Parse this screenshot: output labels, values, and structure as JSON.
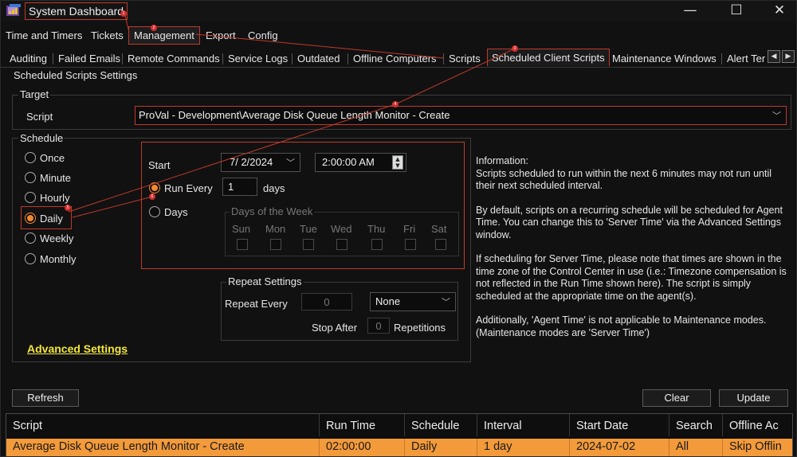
{
  "window": {
    "title": "System Dashboard",
    "minimize": "—",
    "maximize": "☐",
    "close": "✕"
  },
  "menu": [
    "Time and Timers",
    "Tickets",
    "Management",
    "Export",
    "Config"
  ],
  "tabs": [
    "Auditing",
    "Failed Emails",
    "Remote Commands",
    "Service Logs",
    "Outdated",
    "Offline Computers",
    "Scripts",
    "Scheduled Client Scripts",
    "Maintenance Windows",
    "Alert Ter"
  ],
  "panel_title": "Scheduled Scripts Settings",
  "target": {
    "group_label": "Target",
    "script_label": "Script",
    "script_value": "ProVal - Development\\Average Disk Queue Length Monitor - Create"
  },
  "schedule": {
    "group_label": "Schedule",
    "options": [
      "Once",
      "Minute",
      "Hourly",
      "Daily",
      "Weekly",
      "Monthly"
    ],
    "selected": "Daily",
    "start_label": "Start",
    "start_date": "7/  2/2024",
    "start_time": "2:00:00 AM",
    "run_every_label": "Run Every",
    "run_every_value": "1",
    "run_every_unit": "days",
    "days_label": "Days",
    "days_of_week_label": "Days of the Week",
    "weekdays": [
      "Sun",
      "Mon",
      "Tue",
      "Wed",
      "Thu",
      "Fri",
      "Sat"
    ]
  },
  "repeat": {
    "group_label": "Repeat Settings",
    "repeat_every_label": "Repeat Every",
    "repeat_every_value": "0",
    "unit_value": "None",
    "stop_after_label": "Stop After",
    "stop_after_value": "0",
    "repetitions_label": "Repetitions"
  },
  "info": [
    "Information:\nScripts scheduled to run within the next 6 minutes may not run until their next scheduled interval.",
    "By default, scripts on a recurring schedule will be scheduled for Agent Time. You can change this to 'Server Time' via the Advanced Settings window.",
    "If scheduling for Server Time, please note that times are shown in the time zone of the Control Center in use (i.e.: Timezone compensation is not reflected in the Run Time shown here). The script is simply scheduled at the appropriate time on the agent(s).",
    "Additionally, 'Agent Time' is not applicable to Maintenance modes. (Maintenance modes are 'Server Time')"
  ],
  "advanced_settings": "Advanced Settings",
  "buttons": {
    "refresh": "Refresh",
    "clear": "Clear",
    "update": "Update"
  },
  "grid": {
    "columns": [
      "Script",
      "Run Time",
      "Schedule",
      "Interval",
      "Start Date",
      "Search",
      "Offline Ac"
    ],
    "rows": [
      [
        "Average Disk Queue Length Monitor - Create",
        "02:00:00",
        "Daily",
        "1 day",
        "2024-07-02",
        "All",
        "Skip Offlin"
      ]
    ]
  },
  "annotations": [
    "1",
    "2",
    "3",
    "4",
    "5",
    "6"
  ],
  "colors": {
    "highlight": "#c0392b",
    "selected_row": "#f39a3a",
    "link": "#f5e63a",
    "radio_checked": "#f0892e"
  },
  "icons": {
    "app": "dashboard-app-icon",
    "dropdown": "chevron-down-icon",
    "spin": "spin-updown-icon",
    "scroll_left": "scroll-left-icon",
    "scroll_right": "scroll-right-icon"
  }
}
